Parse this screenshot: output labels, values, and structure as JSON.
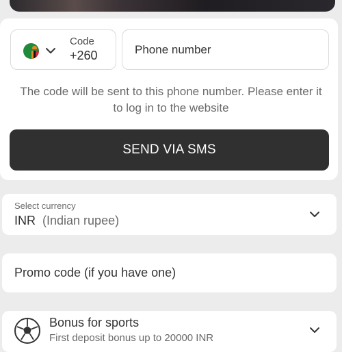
{
  "phone_form": {
    "country": {
      "flag_icon": "zambia-flag-icon",
      "code_label": "Code",
      "code_value": "+260"
    },
    "phone_placeholder": "Phone number",
    "hint": "The code will be sent to this phone number. Please enter it to log in to the website",
    "send_button": "SEND VIA SMS"
  },
  "currency": {
    "label": "Select currency",
    "code": "INR",
    "name": "(Indian rupee)"
  },
  "promo": {
    "placeholder": "Promo code (if you have one)"
  },
  "bonus": {
    "icon": "soccer-ball-icon",
    "title": "Bonus for sports",
    "description": "First deposit bonus up to 20000 INR"
  },
  "colors": {
    "button": "#303030",
    "background": "#ececec",
    "card": "#ffffff"
  }
}
